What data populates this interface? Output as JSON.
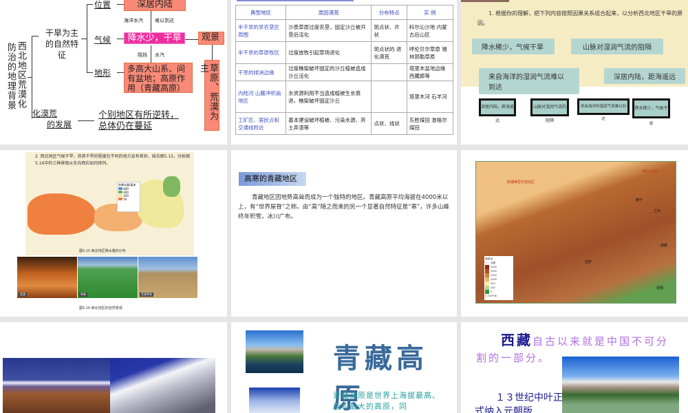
{
  "slides": [
    {
      "id": 1,
      "vertical_title_1": "西北地区荒漠化",
      "vertical_title_2": "防治的地理背景",
      "feature": "干旱为主的自然特征",
      "location_label": "位置",
      "location_box": "深居内陆",
      "ocean_vapor": "海洋水汽",
      "hard_reach": "难以到达",
      "climate_label": "气候",
      "climate_box": "降水少，干旱",
      "landscape": "观景",
      "block": "阻挡",
      "vapor": "水汽",
      "terrain_label": "地形",
      "terrain_box": "多高大山系、间有盆地；高原作用（青藏高原）",
      "grass_box": "草原、荒漠为主",
      "desert_dev_1": "化漠荒",
      "desert_dev_2": "的发展",
      "conclusion_1": "个别地区有所逆转，",
      "conclusion_2": "总体仍在蔓延"
    },
    {
      "id": 2,
      "headers": [
        "典型地区",
        "原因漠荒",
        "分布特点",
        "实 例"
      ],
      "rows": [
        [
          "半干旱的旱农垦区周围",
          "沙质草原过度农垦，固定沙丘被开垦后活化",
          "斑点状、片状",
          "科尔沁沙地 内蒙古后山区"
        ],
        [
          "半干旱的草原牧区",
          "过度放牧引起草场退化",
          "斑点状的 退化漠荒",
          "呼伦贝尔草原 锡林郭勒草原"
        ],
        [
          "干旱的绿洲边缘",
          "过度樵柴破坏固定的沙丘植被造成沙丘活化",
          "",
          "塔里木盆地边缘 西藏廊等"
        ],
        [
          "内陆河 山麓冲积扇地区",
          "水资源利用不当造成植被生长衰退，樵柴破坏固定沙丘",
          "",
          "塔里木河 石羊河"
        ],
        [
          "工矿区、居民点和交通线附近",
          "基本建设破坏植被、污染水源、弃土弃渣等",
          "点状、线状",
          "东胜煤田 准格尔煤田"
        ]
      ]
    },
    {
      "id": 3,
      "question": "1. 根据你的理解，把下列内容按照因果关系组合起来，以分析西北地区干旱的原因。",
      "tags": [
        "降水稀少，气候干旱",
        "山脉对湿润气流的阻隔",
        "来自海洋的湿润气流难以到达",
        "深居内陆，距海遥远"
      ],
      "strips": [
        "深居内陆，距海遥远",
        "山脉对湿润气流的阻隔",
        "来自海洋的湿润气流难以到达",
        "降水稀少，气候干旱"
      ]
    },
    {
      "id": 4,
      "question": "2. 西北地区气候干旱，但其干旱的程度在不同的地方会有差异。结合图5.15，分析图5.16中的三种景观从东向西应如何排列。",
      "legend_title": "年降水量/毫米",
      "legend": [
        "800",
        "400",
        "200",
        "50"
      ],
      "map_caption": "图5.15  西北地区降水量的分布",
      "photo_labels": [
        "荒漠",
        "草原",
        "荒漠草原"
      ],
      "photo_caption": "图5.16  西北地区的自然景观"
    },
    {
      "id": 5,
      "heading": "高寒的青藏地区",
      "body": "青藏地区因地势高耸而成为一个独特的地区。青藏高原平均海拔在4000米以上，有“世界屋脊”之称。由“高”随之而来的另一个显著自然特征是“寒”，许多山峰终年积雪，冰川广布。"
    },
    {
      "id": 6,
      "region_label": "新疆维吾尔自治区",
      "region_label_2": "内蒙古自治区",
      "cities": [
        "西宁",
        "兰州",
        "拉萨",
        "成都",
        "昆明"
      ],
      "legend_title": "海拔/米",
      "legend": [
        "冰雪",
        "5000",
        "3000",
        "2000",
        "1000",
        "500",
        "200",
        "0"
      ],
      "scale": "0   200千米"
    },
    {
      "id": 7
    },
    {
      "id": 8,
      "title": "青藏高原",
      "body": "青藏高原是世界上海拔最高、面积最大的高原，同"
    },
    {
      "id": 9,
      "title_bold": "西藏",
      "title_rest": "自古以来就是中国不可分割的一部分。",
      "body": "１３世纪中叶正式纳入元朝版"
    }
  ],
  "colors": {
    "background": "#e6e6e6",
    "magenta": "#ee2fa0",
    "salmon": "#f98a78",
    "title_blue": "#3a6a9a",
    "teal": "#2aa0a0",
    "purple": "#b070e0"
  }
}
